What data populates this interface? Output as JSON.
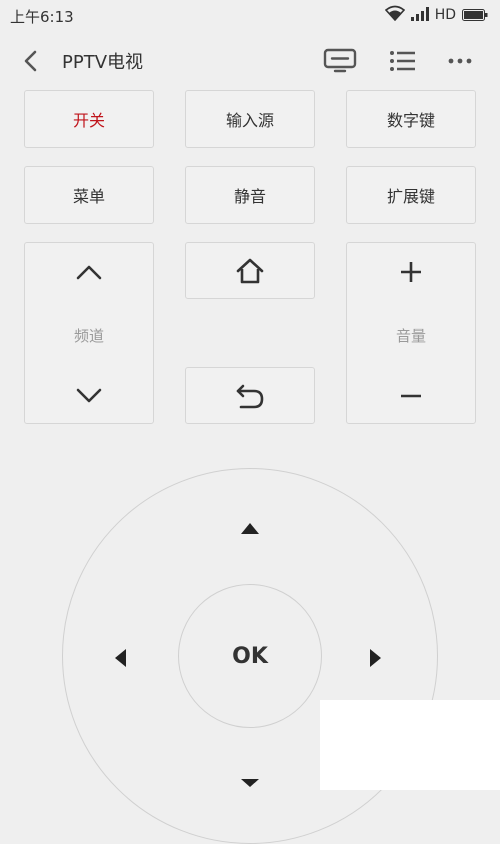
{
  "status": {
    "time": "上午6:13",
    "network": "HD"
  },
  "header": {
    "title": "PPTV电视"
  },
  "keys": {
    "power": "开关",
    "input_source": "输入源",
    "number_keys": "数字键",
    "menu": "菜单",
    "mute": "静音",
    "extend_keys": "扩展键",
    "channel": "频道",
    "volume": "音量"
  },
  "dpad": {
    "ok": "OK"
  },
  "colors": {
    "accent_red": "#c0141b",
    "background": "#efefef"
  }
}
